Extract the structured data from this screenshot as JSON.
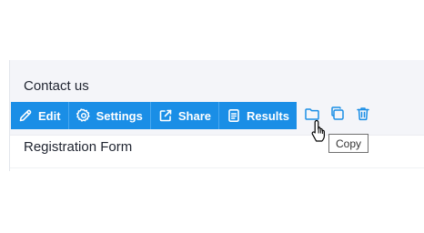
{
  "rows": [
    {
      "title": "Contact us"
    },
    {
      "title": "Registration Form"
    }
  ],
  "toolbar": {
    "edit_label": "Edit",
    "settings_label": "Settings",
    "share_label": "Share",
    "results_label": "Results"
  },
  "tooltip": {
    "text": "Copy"
  },
  "colors": {
    "accent": "#1a8ee6",
    "row_hover_bg": "#f4f5f9"
  },
  "icons": [
    "pencil-icon",
    "gear-icon",
    "share-icon",
    "results-icon",
    "folder-icon",
    "copy-icon",
    "trash-icon",
    "hand-cursor-icon"
  ]
}
